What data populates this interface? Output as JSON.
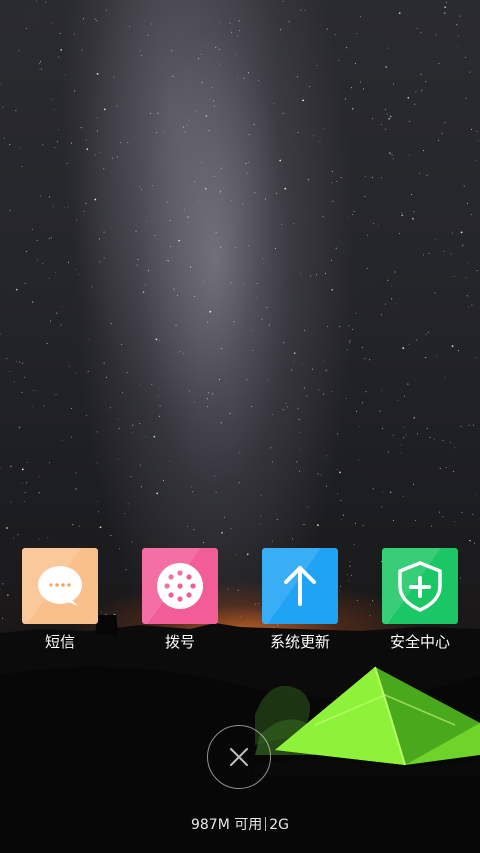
{
  "apps": [
    {
      "label": "短信",
      "icon": "message-bubble-icon",
      "color": "#F9C08C"
    },
    {
      "label": "拨号",
      "icon": "dialpad-icon",
      "color": "#F25C97"
    },
    {
      "label": "系统更新",
      "icon": "arrow-up-icon",
      "color": "#1FA3F4"
    },
    {
      "label": "安全中心",
      "icon": "shield-plus-icon",
      "color": "#1BC764"
    }
  ],
  "close_icon": "close-icon",
  "memory": {
    "available": "987M 可用",
    "total": "2G"
  }
}
